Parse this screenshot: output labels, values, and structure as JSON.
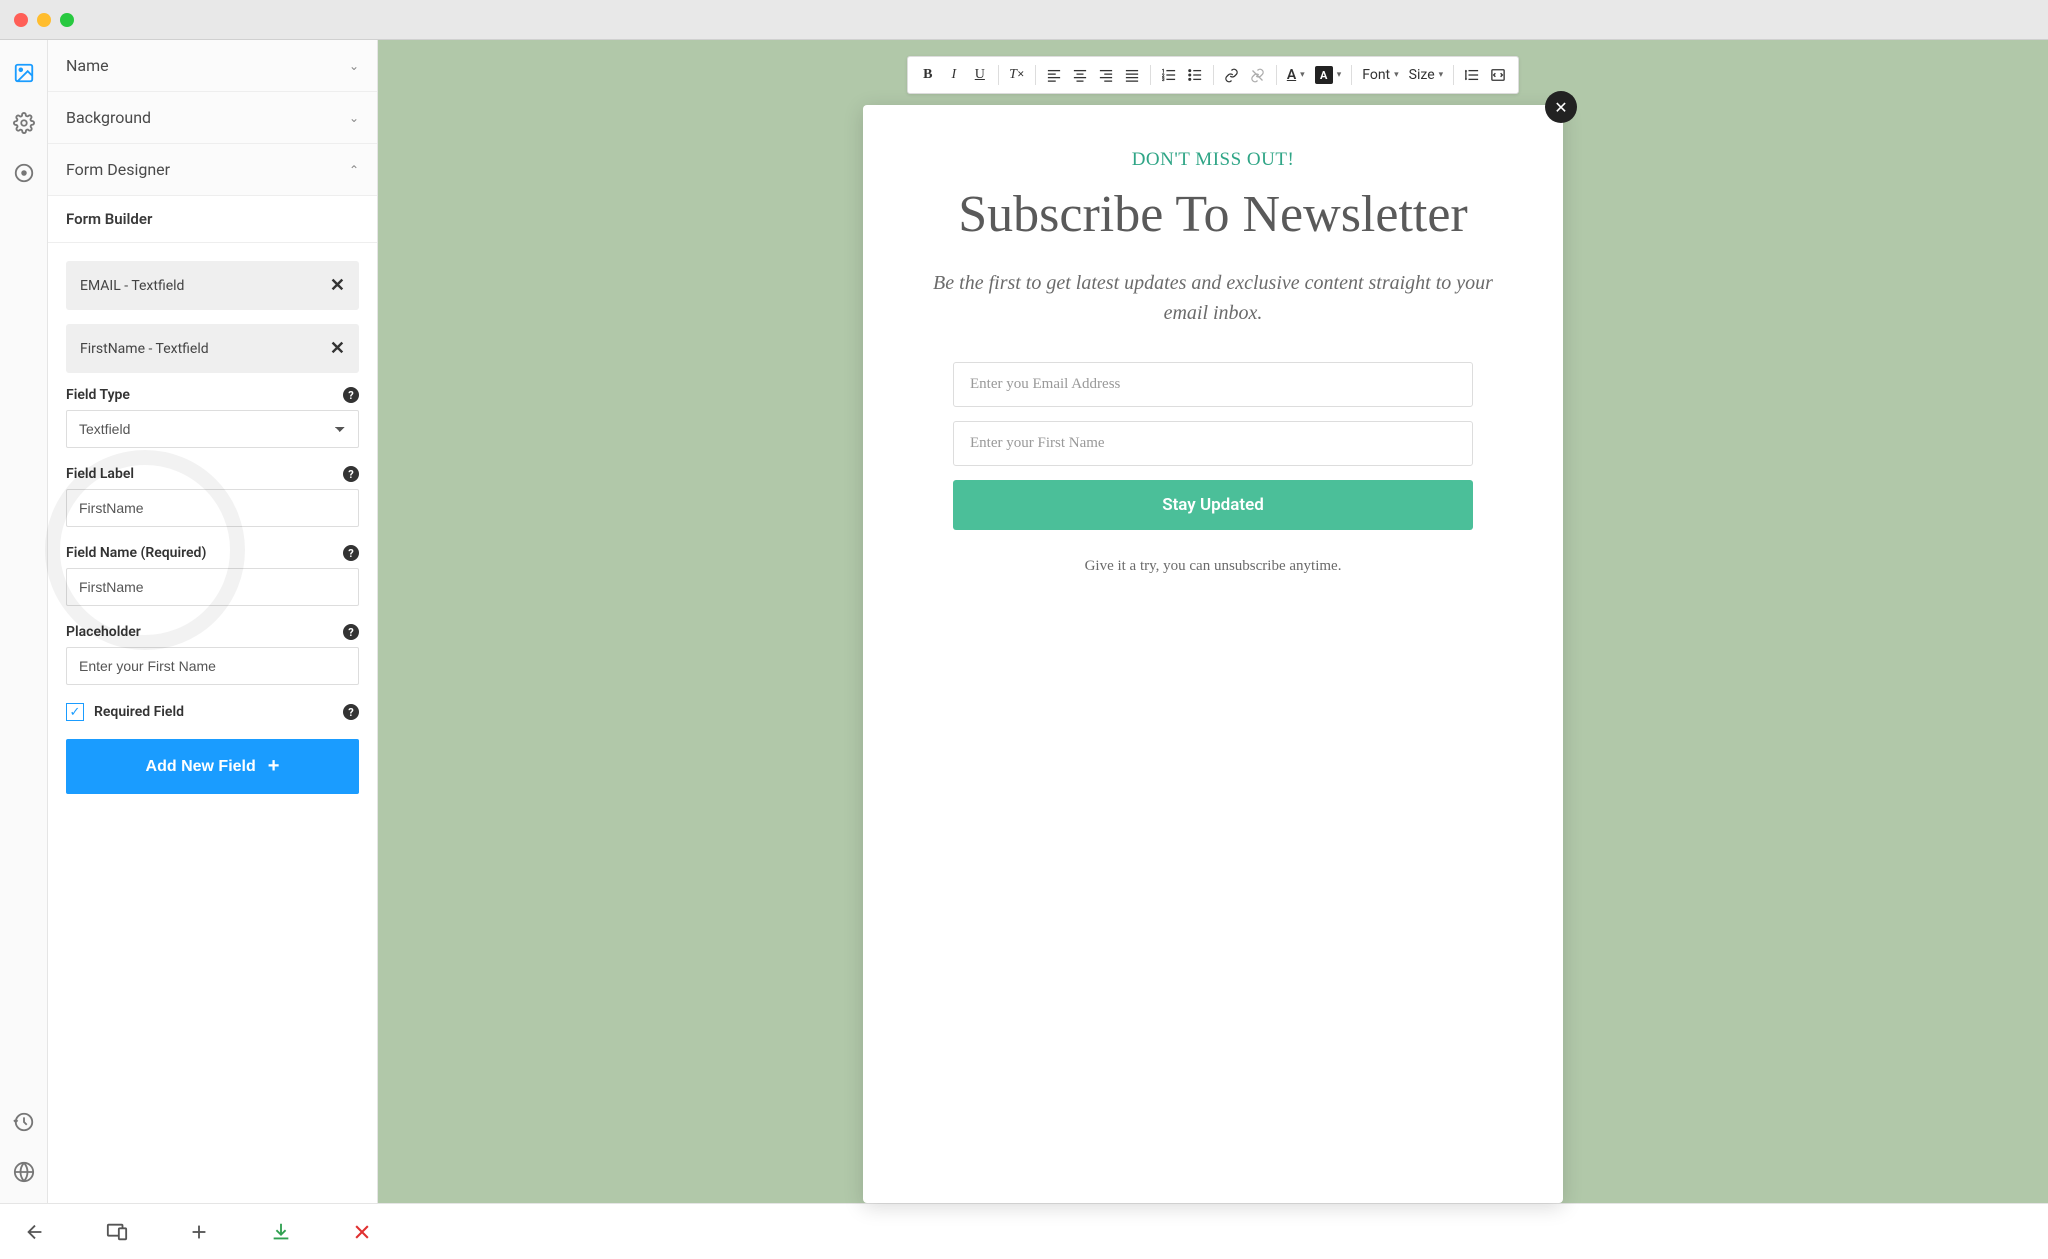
{
  "sections": {
    "name": "Name",
    "background": "Background",
    "formDesigner": "Form Designer",
    "formBuilder": "Form Builder"
  },
  "fields": {
    "email": "EMAIL - Textfield",
    "firstName": "FirstName - Textfield"
  },
  "props": {
    "fieldType": {
      "label": "Field Type",
      "value": "Textfield"
    },
    "fieldLabel": {
      "label": "Field Label",
      "value": "FirstName"
    },
    "fieldName": {
      "label": "Field Name (Required)",
      "value": "FirstName"
    },
    "placeholder": {
      "label": "Placeholder",
      "value": "Enter your First Name"
    },
    "required": {
      "label": "Required Field"
    }
  },
  "addFieldBtn": "Add New Field",
  "toolbar": {
    "font": "Font",
    "size": "Size"
  },
  "popup": {
    "eyebrow": "DON'T MISS OUT!",
    "headline": "Subscribe To Newsletter",
    "sub": "Be the first to get latest updates and exclusive content straight to your email inbox.",
    "emailPlaceholder": "Enter you Email Address",
    "firstNamePlaceholder": "Enter your First Name",
    "cta": "Stay Updated",
    "footnote": "Give it a try, you can unsubscribe anytime."
  }
}
